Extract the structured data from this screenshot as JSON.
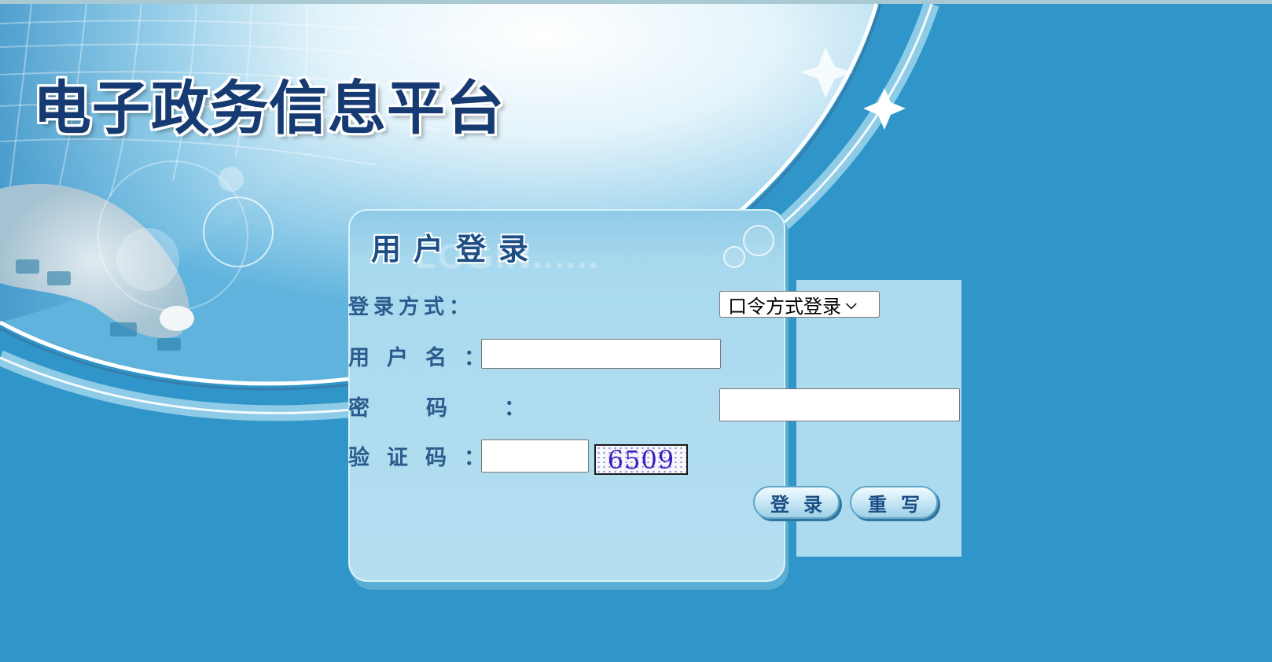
{
  "site_title": "电子政务信息平台",
  "login": {
    "heading": "用户登录",
    "watermark": "LOGIN......",
    "method_label": "登录方式：",
    "method_selected": "口令方式登录",
    "username_label": "用户名：",
    "username_value": "",
    "password_label": "密码：",
    "password_value": "",
    "captcha_label": "验证码：",
    "captcha_value": "",
    "captcha_code": "6509",
    "submit_label": "登录",
    "reset_label": "重写"
  },
  "colors": {
    "background": "#3095c9",
    "panel": "#b5def0",
    "title": "#163a72",
    "label": "#2a5b8c"
  }
}
